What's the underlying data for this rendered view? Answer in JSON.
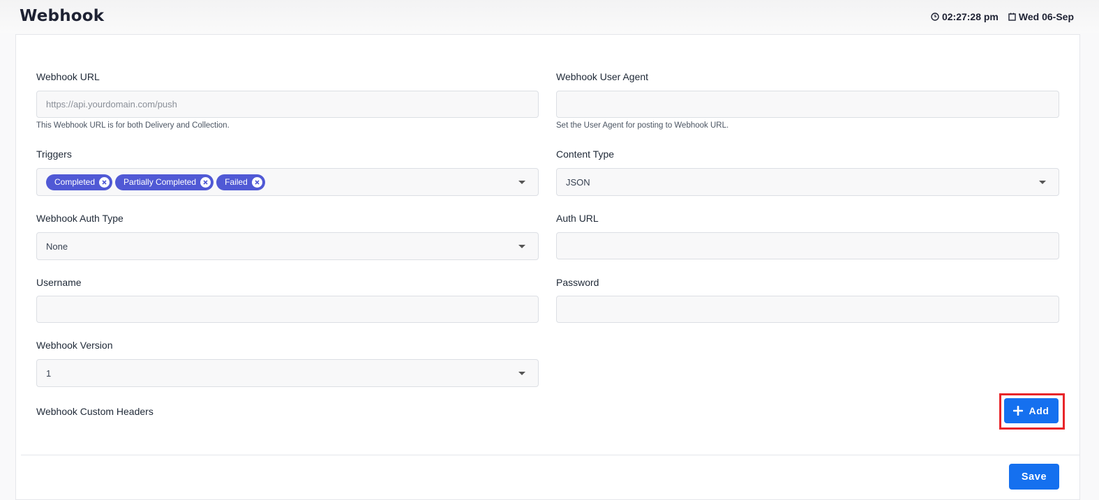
{
  "header": {
    "title": "Webhook",
    "time": "02:27:28 pm",
    "date": "Wed 06-Sep"
  },
  "form": {
    "webhook_url": {
      "label": "Webhook URL",
      "placeholder": "https://api.yourdomain.com/push",
      "value": "",
      "help": "This Webhook URL is for both Delivery and Collection."
    },
    "user_agent": {
      "label": "Webhook User Agent",
      "value": "",
      "help": "Set the User Agent for posting to Webhook URL."
    },
    "triggers": {
      "label": "Triggers",
      "selected": [
        "Completed",
        "Partially Completed",
        "Failed"
      ]
    },
    "content_type": {
      "label": "Content Type",
      "value": "JSON"
    },
    "auth_type": {
      "label": "Webhook Auth Type",
      "value": "None"
    },
    "auth_url": {
      "label": "Auth URL",
      "value": ""
    },
    "username": {
      "label": "Username",
      "value": ""
    },
    "password": {
      "label": "Password",
      "value": ""
    },
    "version": {
      "label": "Webhook Version",
      "value": "1"
    },
    "custom_headers": {
      "label": "Webhook Custom Headers",
      "add_label": "Add"
    },
    "save_label": "Save"
  },
  "colors": {
    "primary": "#1570ef",
    "chip": "#5059d5",
    "highlight": "#e8262a"
  },
  "icons": {
    "clock": "clock-icon",
    "calendar": "calendar-icon",
    "plus": "plus-icon",
    "chip_remove": "close-circle-icon",
    "dropdown": "chevron-down-icon"
  }
}
